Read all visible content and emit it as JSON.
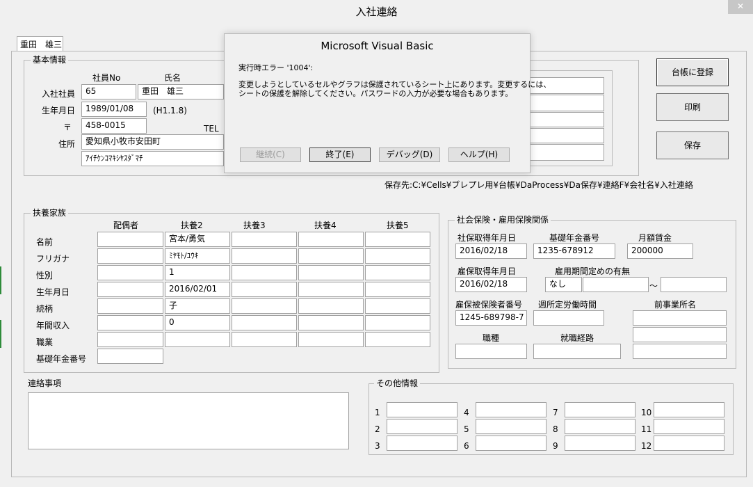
{
  "window": {
    "title": "入社連絡",
    "close_glyph": "✕"
  },
  "tab": {
    "label": "重田　雄三"
  },
  "basic": {
    "legend": "基本情報",
    "col_empno": "社員No",
    "col_name": "氏名",
    "row_employee": "入社社員",
    "row_birth": "生年月日",
    "row_postal": "〒",
    "row_address": "住所",
    "tel": "TEL",
    "emp_no": "65",
    "emp_name": "重田　雄三",
    "birth": "1989/01/08",
    "era_birth": "(H1.1.8)",
    "postal": "458-0015",
    "address": "愛知県小牧市安田町",
    "address_kana": "ｱｲﾁｹﾝｺﾏｷｼﾔｽﾀﾞﾏﾁ"
  },
  "buttons": {
    "register": "台帳に登録",
    "print": "印刷",
    "save": "保存"
  },
  "save_path": "保存先:C:¥Cells¥ブレプレ用¥台帳¥DaProcess¥Da保存¥連絡F¥会社名¥入社連絡",
  "dependents": {
    "legend": "扶養家族",
    "columns": [
      "配偶者",
      "扶養2",
      "扶養3",
      "扶養4",
      "扶養5"
    ],
    "rows": [
      "名前",
      "フリガナ",
      "性別",
      "生年月日",
      "続柄",
      "年間収入",
      "職業",
      "基礎年金番号"
    ],
    "fuyou2": {
      "name": "宮本/勇気",
      "kana": "ﾐﾔﾓﾄ/ﾕｳｷ",
      "gender": "1",
      "birth": "2016/02/01",
      "relation": "子",
      "income": "0"
    }
  },
  "insurance": {
    "legend": "社会保険・雇用保険関係",
    "social_date_label": "社保取得年月日",
    "social_date": "2016/02/18",
    "pension_label": "基礎年金番号",
    "pension": "1235-678912",
    "salary_label": "月額賃金",
    "salary": "200000",
    "emp_date_label": "雇保取得年月日",
    "emp_date": "2016/02/18",
    "term_label": "雇用期間定めの有無",
    "term": "なし",
    "tilde": "～",
    "insured_label": "雇保被保険者番号",
    "insured": "1245-689798-7",
    "hours_label": "週所定労働時間",
    "prev_office_label": "前事業所名",
    "job_label": "職種",
    "route_label": "就職経路"
  },
  "notes": {
    "legend": "連絡事項"
  },
  "other": {
    "legend": "その他情報",
    "numbers": [
      "1",
      "2",
      "3",
      "4",
      "5",
      "6",
      "7",
      "8",
      "9",
      "10",
      "11",
      "12"
    ]
  },
  "dialog": {
    "title": "Microsoft Visual Basic",
    "error_line": "実行時エラー '1004':",
    "message_line1": "変更しようとしているセルやグラフは保護されているシート上にあります。変更するには、",
    "message_line2": "シートの保護を解除してください。パスワードの入力が必要な場合もあります。",
    "btn_continue": "継続(C)",
    "btn_end": "終了(E)",
    "btn_debug": "デバッグ(D)",
    "btn_help": "ヘルプ(H)"
  }
}
